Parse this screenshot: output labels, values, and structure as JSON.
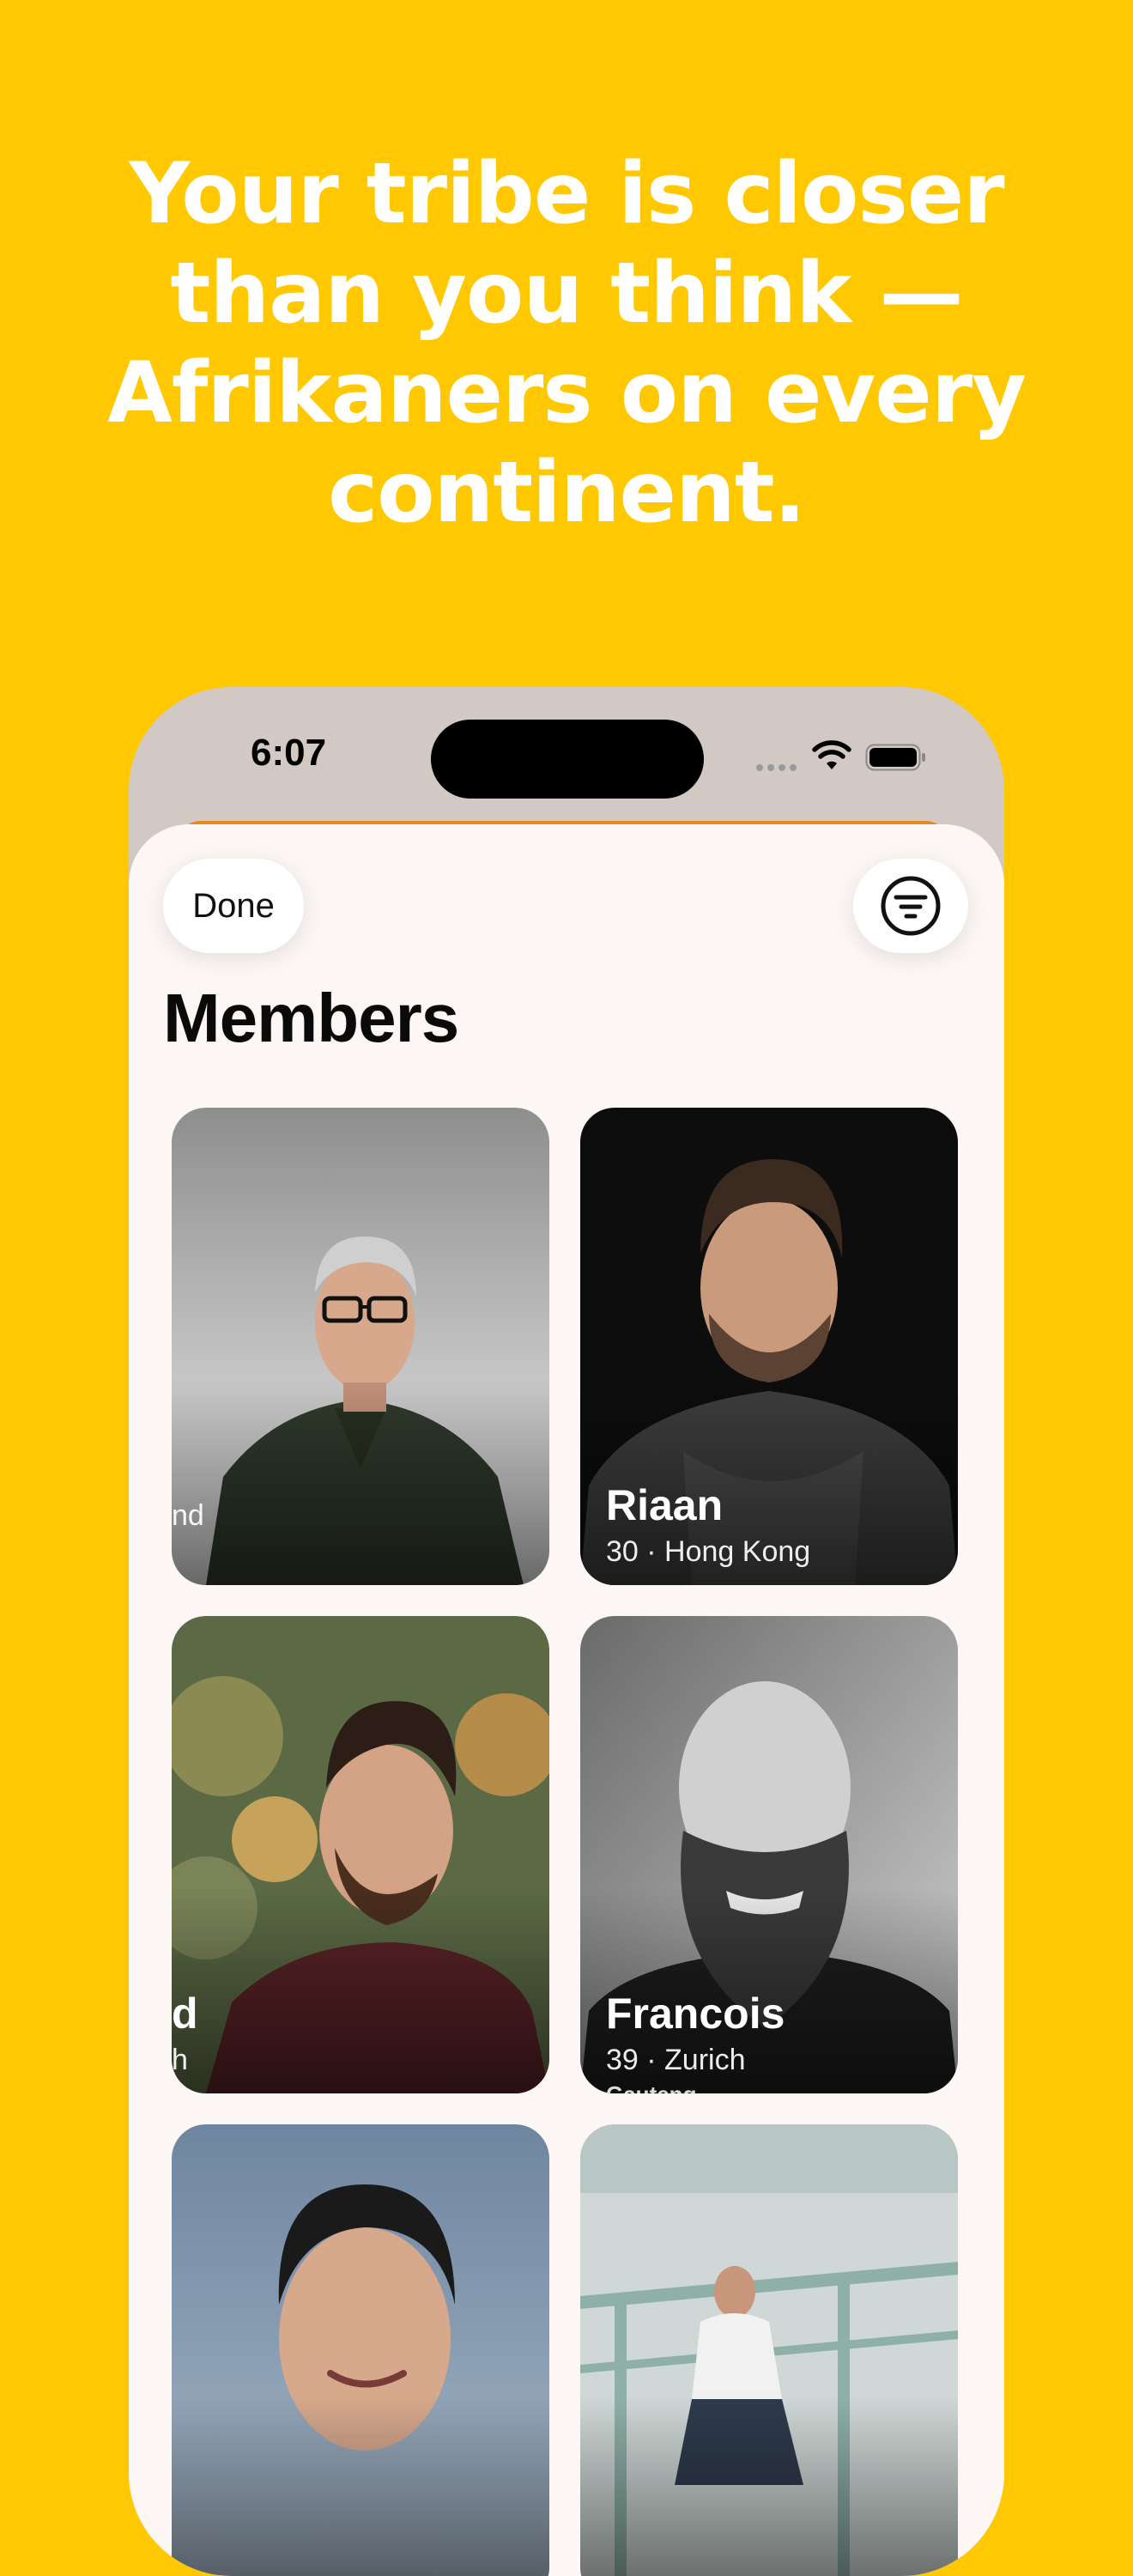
{
  "headline": "Your tribe is closer than you think — Afrikaners on every continent.",
  "status_bar": {
    "time": "6:07",
    "icons": [
      "signal-icon",
      "wifi-icon",
      "battery-icon"
    ]
  },
  "toolbar": {
    "done_label": "Done",
    "filter_icon": "filter-icon"
  },
  "page_title": "Members",
  "colors": {
    "background": "#FFC800",
    "sheet": "#FCF7F4",
    "text_on_brand": "#FFFFFF"
  },
  "members": [
    {
      "name": "",
      "meta": "",
      "region": "",
      "name_clipped": "",
      "meta_clipped": "nd",
      "photo": "man-with-glasses-grey-background"
    },
    {
      "name": "Riaan",
      "meta": "30 · Hong Kong",
      "region": "",
      "photo": "man-dark-sweater-black-background"
    },
    {
      "name": "",
      "meta": "",
      "region": "",
      "name_clipped": "d",
      "meta_clipped": "h",
      "photo": "bearded-man-profile-outdoors"
    },
    {
      "name": "Francois",
      "meta": "39 · Zurich",
      "region": "Gauteng",
      "photo": "bald-bearded-man-black-and-white"
    },
    {
      "name": "",
      "meta": "",
      "region": "",
      "photo": "smiling-man-blue-background"
    },
    {
      "name": "",
      "meta": "",
      "region": "",
      "photo": "man-sitting-on-pier"
    }
  ]
}
